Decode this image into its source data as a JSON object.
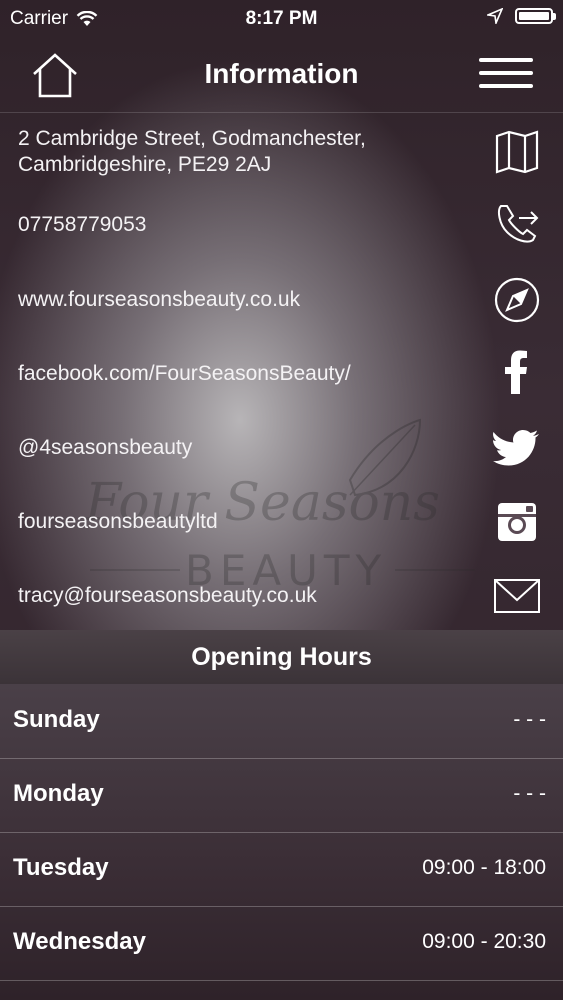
{
  "status_bar": {
    "carrier": "Carrier",
    "time": "8:17 PM",
    "battery_level": 1.0,
    "icons": [
      "wifi-icon",
      "location-arrow-icon",
      "battery-icon"
    ]
  },
  "navbar": {
    "title": "Information",
    "home_icon": "home-icon",
    "menu_icon": "hamburger-menu-icon"
  },
  "info": {
    "address": {
      "line1": "2 Cambridge Street, Godmanchester,",
      "line2": "Cambridgeshire, PE29 2AJ",
      "icon": "map-icon"
    },
    "phone": {
      "text": "07758779053",
      "icon": "phone-icon"
    },
    "website": {
      "text": "www.fourseasonsbeauty.co.uk",
      "icon": "compass-icon"
    },
    "facebook": {
      "text": "facebook.com/FourSeasonsBeauty/",
      "icon": "facebook-icon"
    },
    "twitter": {
      "text": "@4seasonsbeauty",
      "icon": "twitter-icon"
    },
    "instagram": {
      "text": "fourseasonsbeautyltd",
      "icon": "instagram-icon"
    },
    "email": {
      "text": "tracy@fourseasonsbeauty.co.uk",
      "icon": "mail-icon"
    }
  },
  "watermark": {
    "line1": "Four Seasons",
    "line2": "BEAUTY"
  },
  "opening_hours": {
    "title": "Opening Hours",
    "days": [
      {
        "day": "Sunday",
        "hours": "- - -"
      },
      {
        "day": "Monday",
        "hours": "- - -"
      },
      {
        "day": "Tuesday",
        "hours": "09:00 - 18:00"
      },
      {
        "day": "Wednesday",
        "hours": "09:00 - 20:30"
      }
    ]
  },
  "colors": {
    "background": "#2f2229",
    "text": "#ffffff",
    "header_bar": "#433a3f"
  }
}
